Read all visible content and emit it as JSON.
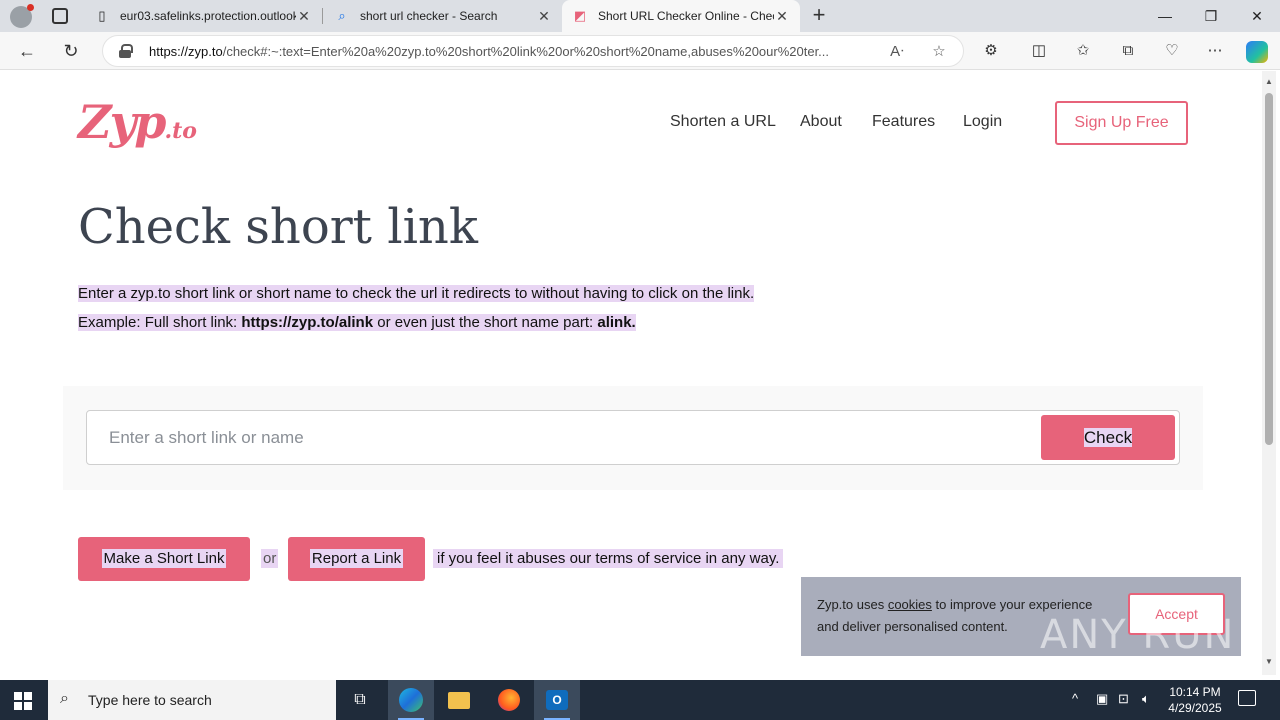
{
  "browser": {
    "tabs": [
      {
        "label": "eur03.safelinks.protection.outlook.com",
        "icon": "page-icon"
      },
      {
        "label": "short url checker - Search",
        "icon": "search-icon"
      },
      {
        "label": "Short URL Checker Online - Check",
        "icon": "zyp-icon"
      }
    ],
    "url_host": "https://zyp.to",
    "url_rest": "/check#:~:text=Enter%20a%20zyp.to%20short%20link%20or%20short%20name,abuses%20our%20ter..."
  },
  "site": {
    "logo_main": "Zyp",
    "logo_suffix": ".to",
    "nav": [
      "Shorten a URL",
      "About",
      "Features",
      "Login"
    ],
    "signup": "Sign Up Free"
  },
  "main": {
    "title": "Check short link",
    "desc_line1": "Enter a zyp.to short link or short name to check the url it redirects to without having to click on the link.",
    "desc_line2_prefix": "Example: Full short link: ",
    "desc_line2_link": "https://zyp.to/alink",
    "desc_line2_mid": " or even just the short name part: ",
    "desc_line2_name": "alink.",
    "input_placeholder": "Enter a short link or name",
    "check_button": "Check",
    "make_link_button": "Make a Short Link",
    "or_text": "or",
    "report_button": "Report a Link",
    "report_tail": "if you feel it abuses our terms of service in any way."
  },
  "cookie": {
    "text_prefix": "Zyp.to uses ",
    "link": "cookies",
    "text_suffix": " to improve your experience and deliver personalised content.",
    "accept": "Accept"
  },
  "watermark": "ANY RUN",
  "taskbar": {
    "search_placeholder": "Type here to search",
    "time": "10:14 PM",
    "date": "4/29/2025"
  },
  "colors": {
    "brand": "#e7637a",
    "highlight": "#e8d5f3",
    "taskbar": "#1f2b3a"
  }
}
